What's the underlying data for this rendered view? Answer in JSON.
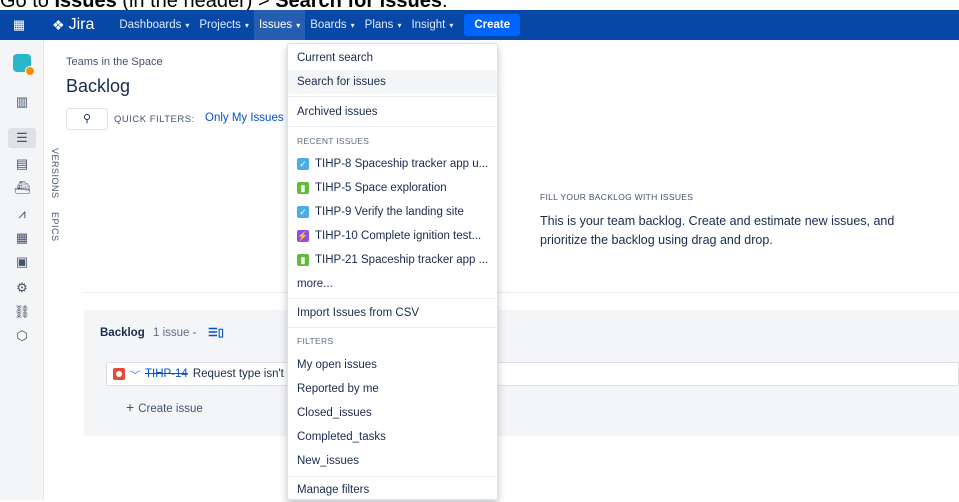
{
  "caption": {
    "prefix": "Go to ",
    "issues": "Issues",
    "middle": " (in the header) > ",
    "target": "Search for issues",
    "suffix": "."
  },
  "topnav": {
    "logo": "Jira",
    "items": [
      {
        "label": "Dashboards"
      },
      {
        "label": "Projects"
      },
      {
        "label": "Issues"
      },
      {
        "label": "Boards"
      },
      {
        "label": "Plans"
      },
      {
        "label": "Insight"
      }
    ],
    "create": "Create"
  },
  "icons": {
    "apps": "apps-grid-icon",
    "logo": "jira-logo-icon",
    "chevron": "chevron-down-icon"
  },
  "breadcrumb": "Teams in the Space",
  "page_title": "Backlog",
  "quick_filters": {
    "label": "QUICK FILTERS:",
    "only_my_issues": "Only My Issues"
  },
  "vertical_tabs": {
    "versions": "VERSIONS",
    "epics": "EPICS"
  },
  "empty_state": {
    "title": "FILL YOUR BACKLOG WITH ISSUES",
    "desc": "This is your team backlog. Create and estimate new issues, and prioritize the backlog using drag and drop."
  },
  "backlog": {
    "title": "Backlog",
    "count": "1 issue -",
    "issue_key": "TIHP-14",
    "issue_summary": "Request type isn't",
    "create_issue": "Create issue"
  },
  "dropdown": {
    "current_search": "Current search",
    "search_for_issues": "Search for issues",
    "archived_issues": "Archived issues",
    "recent_header": "RECENT ISSUES",
    "recent": [
      {
        "type": "task",
        "label": "TIHP-8 Spaceship tracker app u..."
      },
      {
        "type": "story",
        "label": "TIHP-5 Space exploration"
      },
      {
        "type": "task",
        "label": "TIHP-9 Verify the landing site"
      },
      {
        "type": "epic",
        "label": "TIHP-10 Complete ignition test..."
      },
      {
        "type": "story",
        "label": "TIHP-21 Spaceship tracker app ..."
      }
    ],
    "more": "more...",
    "import_csv": "Import Issues from CSV",
    "filters_header": "FILTERS",
    "filters": [
      "My open issues",
      "Reported by me",
      "Closed_issues",
      "Completed_tasks",
      "New_issues"
    ],
    "manage_filters": "Manage filters"
  }
}
